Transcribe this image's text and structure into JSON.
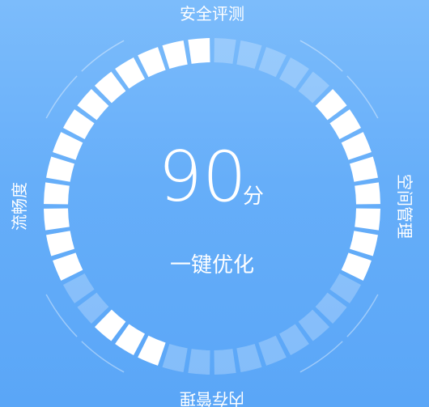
{
  "score": {
    "value": "90",
    "unit": "分"
  },
  "action": {
    "optimize_label": "一键优化"
  },
  "gauges": [
    {
      "id": "security",
      "label": "安全评测",
      "segments": 10,
      "filled": 5
    },
    {
      "id": "space",
      "label": "空间管理",
      "segments": 10,
      "filled": 8
    },
    {
      "id": "memory",
      "label": "内存管理",
      "segments": 10,
      "filled": 3
    },
    {
      "id": "fluency",
      "label": "流畅度",
      "segments": 10,
      "filled": 8
    }
  ],
  "colors": {
    "background_top": "#7cbcfb",
    "background_bottom": "#5aa6f7",
    "segment_filled": "#ffffff",
    "segment_empty": "#ffffff40",
    "outer_ring": "#ffffff66",
    "text": "#ffffff"
  }
}
